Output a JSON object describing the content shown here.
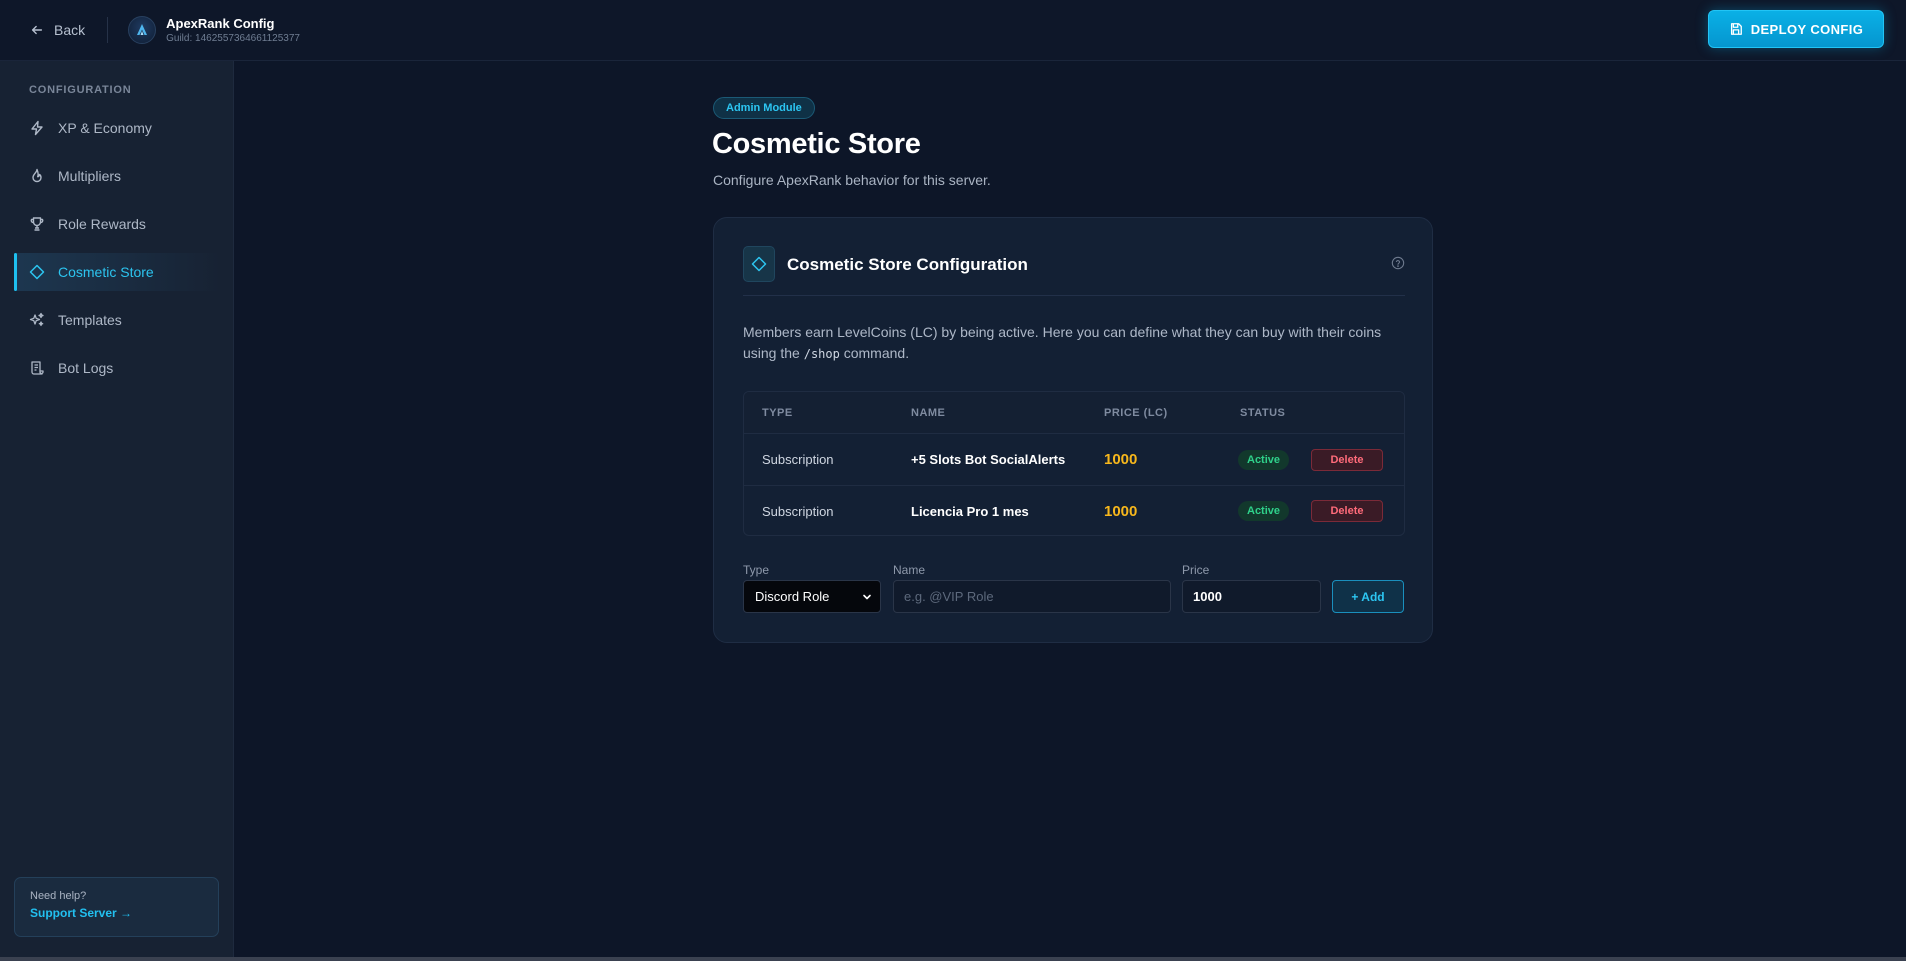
{
  "header": {
    "back_label": "Back",
    "app_title": "ApexRank Config",
    "guild_label": "Guild: 1462557364661125377",
    "deploy_label": "DEPLOY CONFIG"
  },
  "sidebar": {
    "heading": "CONFIGURATION",
    "items": [
      {
        "label": "XP & Economy",
        "icon": "lightning-icon"
      },
      {
        "label": "Multipliers",
        "icon": "flame-icon"
      },
      {
        "label": "Role Rewards",
        "icon": "trophy-icon"
      },
      {
        "label": "Cosmetic Store",
        "icon": "diamond-icon",
        "active": true
      },
      {
        "label": "Templates",
        "icon": "sparkles-icon"
      },
      {
        "label": "Bot Logs",
        "icon": "scroll-icon"
      }
    ],
    "help": {
      "question": "Need help?",
      "link": "Support Server →"
    }
  },
  "main": {
    "badge": "Admin Module",
    "title": "Cosmetic Store",
    "subtitle": "Configure ApexRank behavior for this server.",
    "card": {
      "title": "Cosmetic Store Configuration",
      "desc_before": "Members earn LevelCoins (LC) by being active. Here you can define what they can buy with their coins using the ",
      "desc_code": "/shop",
      "desc_after": " command.",
      "table": {
        "columns": [
          "TYPE",
          "NAME",
          "PRICE (LC)",
          "STATUS"
        ],
        "rows": [
          {
            "type": "Subscription",
            "name": "+5 Slots Bot SocialAlerts",
            "price": "1000",
            "status": "Active",
            "action": "Delete"
          },
          {
            "type": "Subscription",
            "name": "Licencia Pro 1 mes",
            "price": "1000",
            "status": "Active",
            "action": "Delete"
          }
        ]
      },
      "form": {
        "type_label": "Type",
        "type_value": "Discord Role",
        "name_label": "Name",
        "name_placeholder": "e.g. @VIP Role",
        "name_value": "",
        "price_label": "Price",
        "price_value": "1000",
        "add_label": "+ Add"
      }
    }
  },
  "colors": {
    "accent": "#1ec0f0",
    "price": "#f7b71c",
    "status_active": "#2fd18b",
    "danger": "#ff6b7a"
  }
}
